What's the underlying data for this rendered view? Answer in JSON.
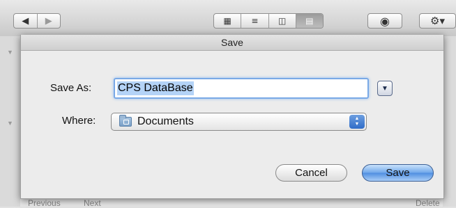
{
  "background": {
    "toolbar": {
      "back_icon": "◀",
      "forward_icon": "▶",
      "view_icons": [
        "icon-view",
        "list-view",
        "column-view",
        "coverflow-view"
      ],
      "quicklook_icon": "eye-icon",
      "action_icon": "gear-icon"
    },
    "bottom": {
      "previous": "Previous",
      "next": "Next",
      "delete": "Delete"
    }
  },
  "sheet": {
    "title": "Save",
    "save_as_label": "Save As:",
    "filename": "CPS DataBase",
    "where_label": "Where:",
    "where_value": "Documents",
    "cancel_label": "Cancel",
    "save_label": "Save"
  },
  "colors": {
    "focus_ring": "#7aa9e6",
    "default_button": "#4f8ee0",
    "selection": "#b4d3f7"
  }
}
